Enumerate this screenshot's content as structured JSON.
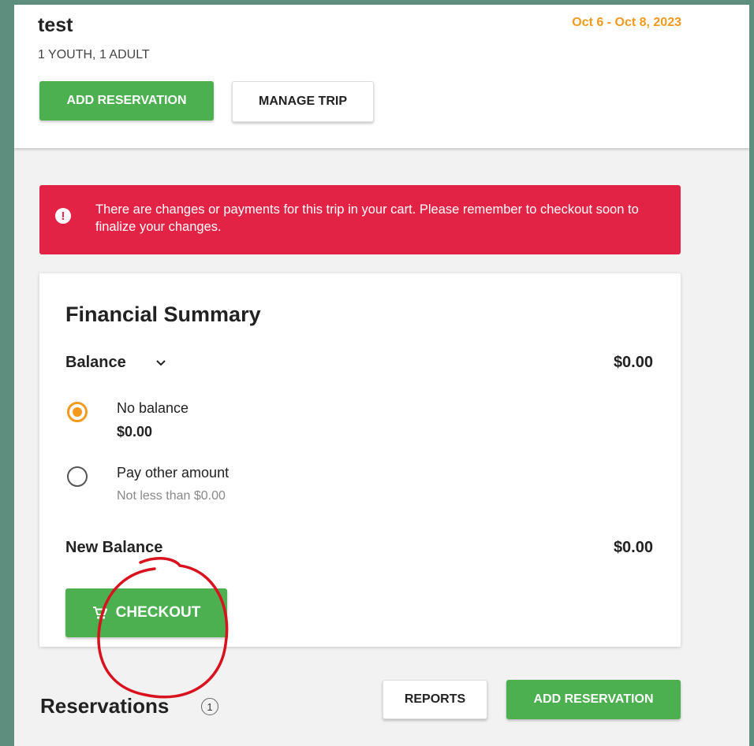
{
  "trip": {
    "title": "test",
    "party": "1 YOUTH, 1 ADULT",
    "dates": "Oct 6 - Oct 8, 2023",
    "add_reservation_label": "ADD RESERVATION",
    "manage_trip_label": "MANAGE TRIP"
  },
  "alert": {
    "icon": "exclamation-icon",
    "message": "There are changes or payments for this trip in your cart. Please remember to checkout soon to finalize your changes."
  },
  "financial_summary": {
    "title": "Financial Summary",
    "balance_label": "Balance",
    "balance_value": "$0.00",
    "options": [
      {
        "label": "No balance",
        "amount": "$0.00",
        "selected": true
      },
      {
        "label": "Pay other amount",
        "sub": "Not less than $0.00",
        "selected": false
      }
    ],
    "new_balance_label": "New Balance",
    "new_balance_value": "$0.00",
    "checkout_label": "CHECKOUT",
    "checkout_icon": "cart-icon"
  },
  "reservations": {
    "title": "Reservations",
    "count": "1",
    "reports_label": "REPORTS",
    "add_reservation_label": "ADD RESERVATION"
  },
  "colors": {
    "accent_orange": "#f39a1d",
    "primary_green": "#4caf50",
    "alert_red": "#e32346",
    "annotation_red": "#d8121f",
    "outer_background": "#5e8f7e"
  }
}
